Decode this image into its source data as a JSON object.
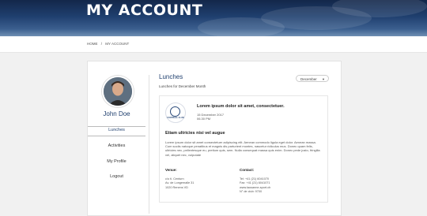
{
  "page": {
    "title": "MY ACCOUNT"
  },
  "breadcrumb": {
    "home": "HOME",
    "separator": "/",
    "current": "MY ACCOUNT"
  },
  "profile": {
    "name": "John Doe"
  },
  "menu": [
    {
      "label": "Lunches",
      "active": true
    },
    {
      "label": "Activities",
      "active": false
    },
    {
      "label": "My Profile",
      "active": false
    },
    {
      "label": "Logout",
      "active": false
    }
  ],
  "section": {
    "title": "Lunches",
    "subtitle": "Lunches for December Month"
  },
  "month_select": {
    "value": "December"
  },
  "event": {
    "logo_text": "FOOTBALL CLUB",
    "title": "Lorem ipsum dolor sit amet, consectetuer.",
    "date": "15 December 2017",
    "time": "06.30 PM",
    "heading": "Etiam ultricies nisi vel augue",
    "description": "Lorem ipsum dolor sit amet consectetuer adipiscing elit. Aenean commodo ligula eget dolor. Aenean massa. Cum sociis natoque penatibus et magnis dis parturient montes, nascetur ridiculus mus. Donec quam felis, ultricies nec, pellentesque eu, pretium quis, sem. Nulla consequat massa quis enim. Donec pede justo, fringilla vel, aliquet nec, vulputate",
    "venue_label": "Venue:",
    "venue_lines": [
      "c/o ti. Centurn",
      "Av. de Longemalle 31",
      "1020 Renens VD"
    ],
    "contact_label": "Contact:",
    "contact_lines": [
      "Tel: +41 (21) 6041070",
      "Fax: +41 (21) 6041071",
      "www.lausanne-sport.ch",
      "N° de club: 9700"
    ]
  },
  "colors": {
    "accent": "#1f3f6e",
    "hero_top": "#13274a",
    "hero_bottom": "#6f8fb3"
  }
}
